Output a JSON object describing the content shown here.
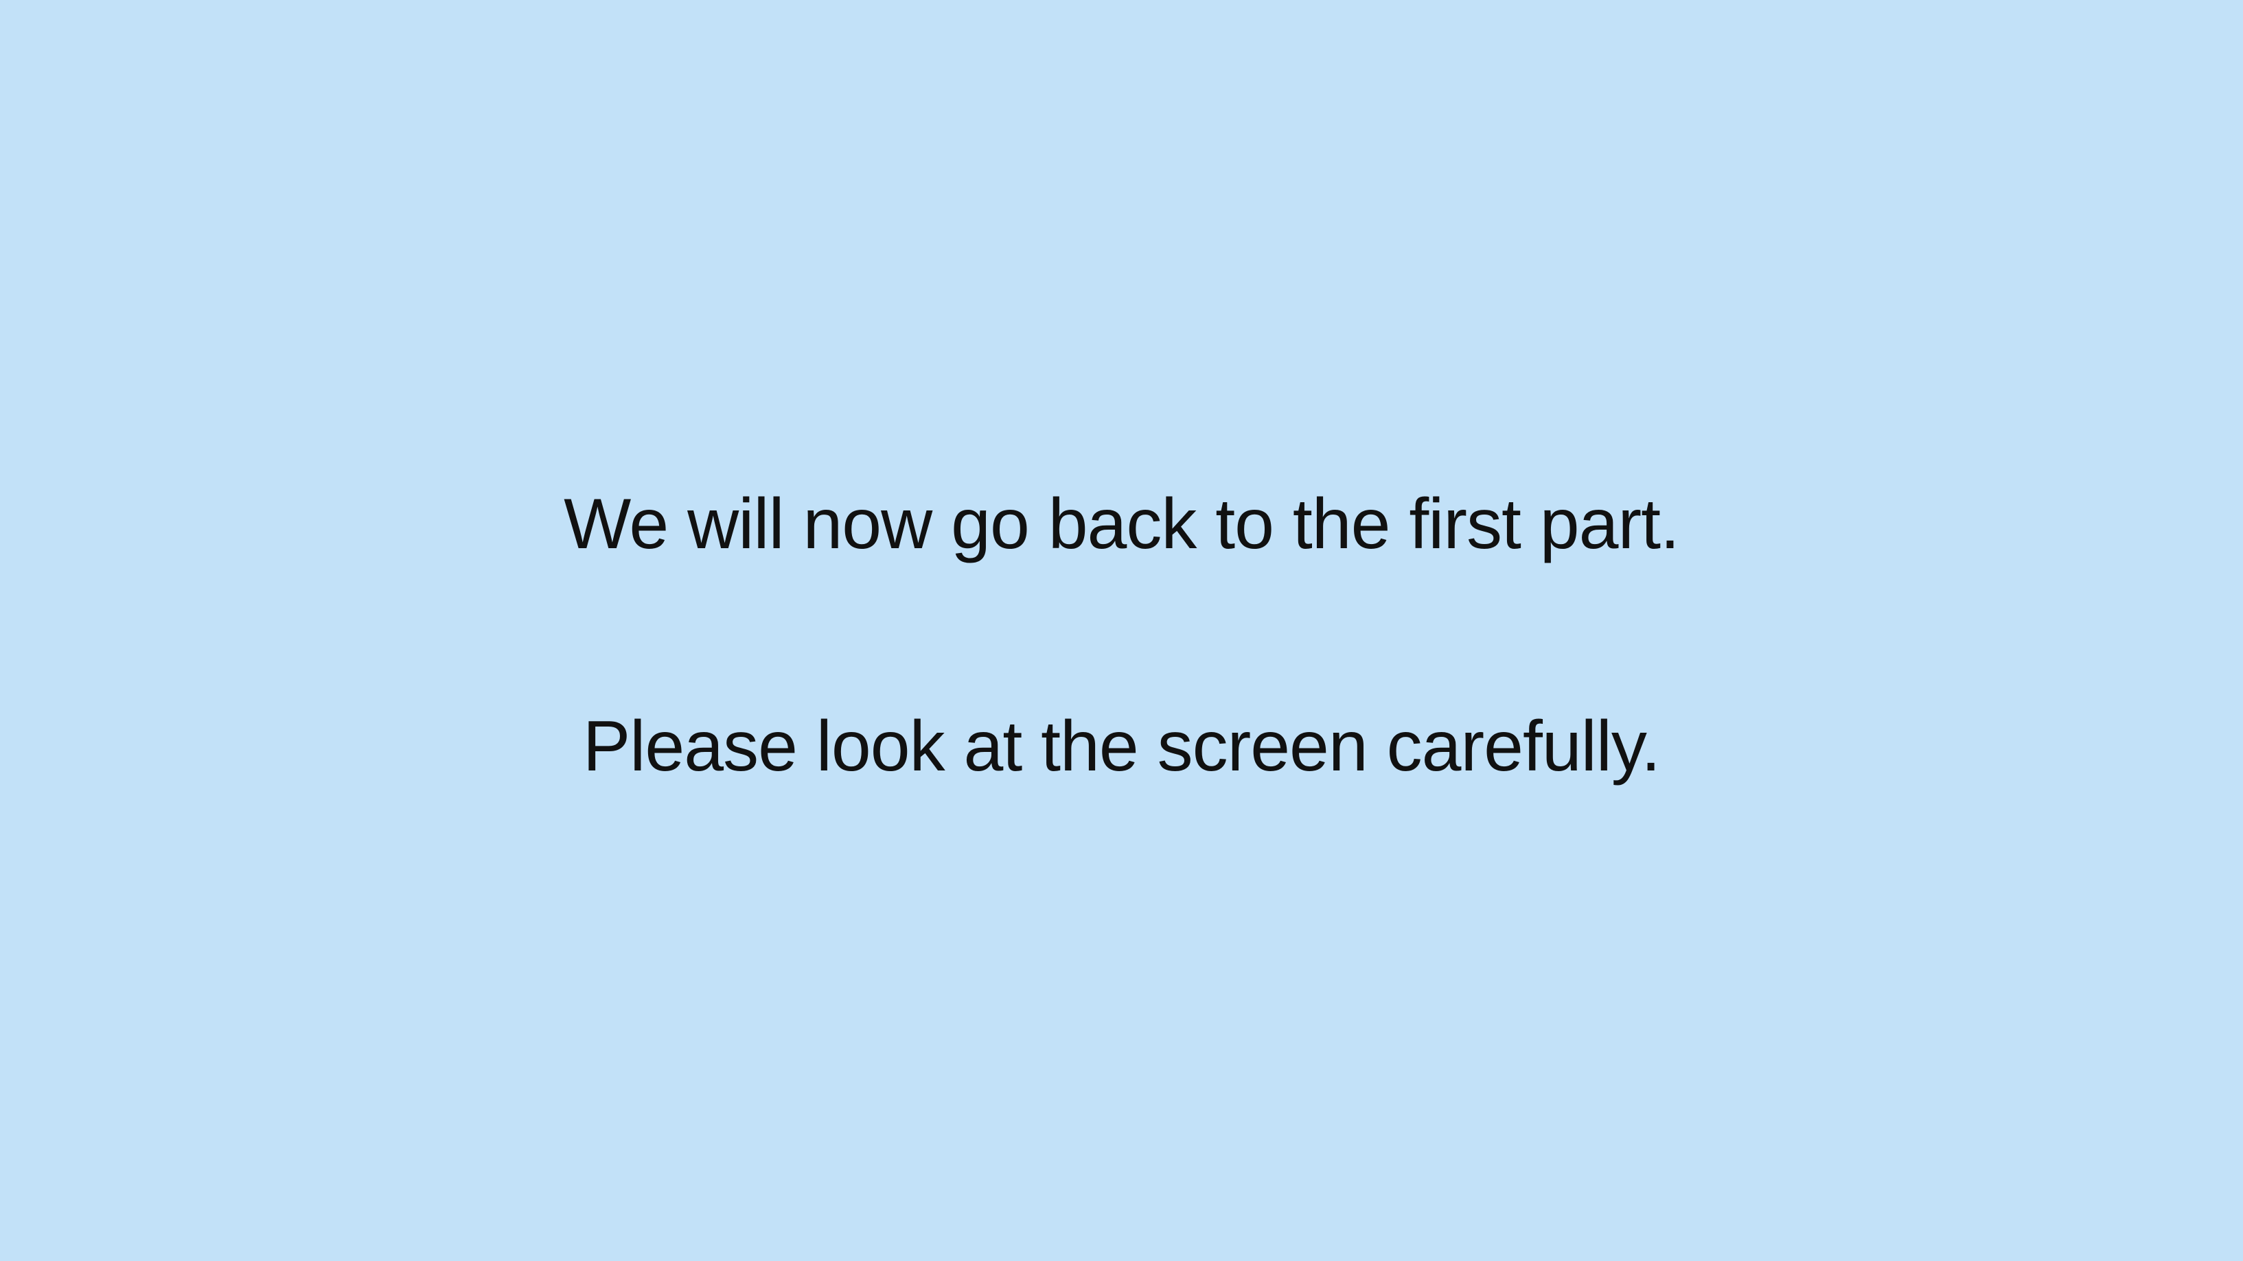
{
  "screen": {
    "background_color": "#c2e1f8",
    "text_color": "#111111",
    "message_line_1": "We will now go back to the first part.",
    "message_line_2": "Please look at the screen carefully."
  }
}
